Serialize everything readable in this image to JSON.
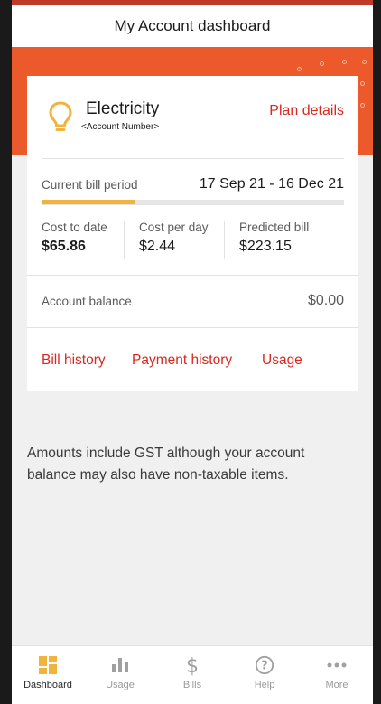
{
  "header": {
    "title": "My Account dashboard"
  },
  "account": {
    "service_name": "Electricity",
    "account_number": "<Account Number>",
    "plan_details_label": "Plan details"
  },
  "billing": {
    "period_label": "Current bill period",
    "period_value": "17 Sep 21 - 16 Dec 21",
    "period_progress_percent": 31
  },
  "stats": [
    {
      "label": "Cost to date",
      "value": "$65.86"
    },
    {
      "label": "Cost per day",
      "value": "$2.44"
    },
    {
      "label": "Predicted bill",
      "value": "$223.15"
    }
  ],
  "balance": {
    "label": "Account balance",
    "value": "$0.00"
  },
  "links": {
    "bill_history": "Bill history",
    "payment_history": "Payment history",
    "usage": "Usage"
  },
  "note": "Amounts include GST although your account balance may also have non-taxable items.",
  "tabs": [
    {
      "label": "Dashboard",
      "icon": "dashboard-icon",
      "active": true
    },
    {
      "label": "Usage",
      "icon": "bar-chart-icon",
      "active": false
    },
    {
      "label": "Bills",
      "icon": "dollar-icon",
      "active": false
    },
    {
      "label": "Help",
      "icon": "help-icon",
      "active": false
    },
    {
      "label": "More",
      "icon": "more-icon",
      "active": false
    }
  ],
  "colors": {
    "brand_orange": "#ec5a2c",
    "link_red": "#d8281f",
    "progress_yellow": "#f2b33d",
    "icon_yellow": "#f2b33d",
    "inactive_icon": "#a0a0a0"
  }
}
